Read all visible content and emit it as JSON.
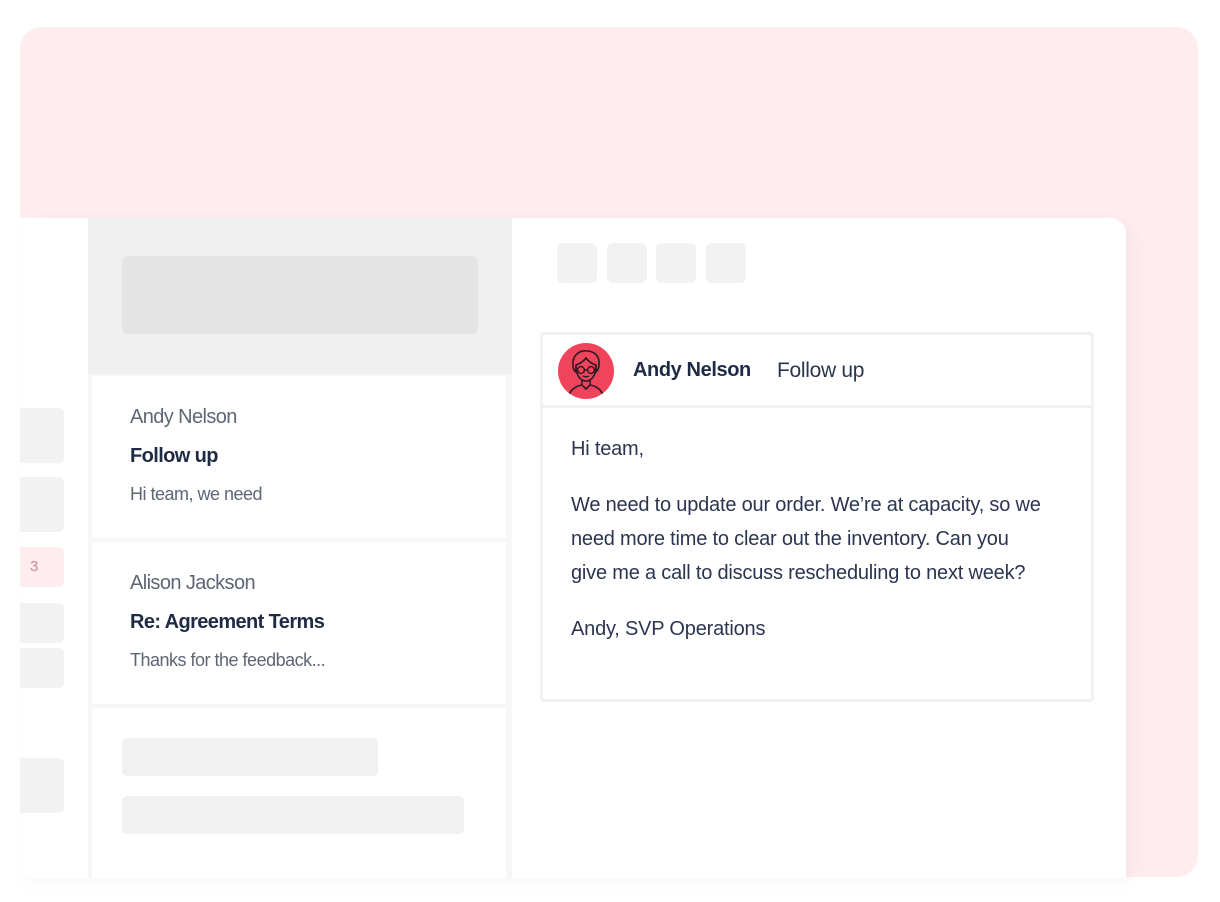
{
  "rail": {
    "badge_count": "3"
  },
  "messages": [
    {
      "from": "Andy Nelson",
      "subject": "Follow up",
      "preview": "Hi team, we need"
    },
    {
      "from": "Alison Jackson",
      "subject": "Re: Agreement Terms",
      "preview": "Thanks for the feedback..."
    }
  ],
  "email": {
    "sender": "Andy Nelson",
    "subject": "Follow up",
    "greeting": "Hi team,",
    "body": "We need to update our order. We’re at capacity, so we need more time to clear out the inventory. Can you give me a call to discuss rescheduling to next week?",
    "signature": "Andy, SVP Operations"
  },
  "colors": {
    "accent_pink": "#ffecee",
    "avatar_red": "#f0435c",
    "text_dark": "#1f2a44"
  }
}
